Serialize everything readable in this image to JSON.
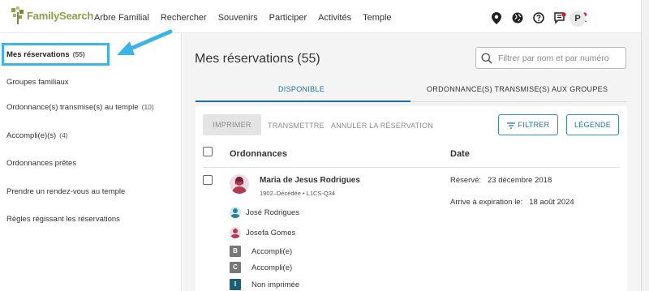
{
  "header": {
    "logo_text": "FamilySearch",
    "nav": [
      "Arbre Familial",
      "Rechercher",
      "Souvenirs",
      "Participer",
      "Activités",
      "Temple"
    ],
    "avatar_initial": "P"
  },
  "sidebar": {
    "items": [
      {
        "label": "Mes réservations",
        "count": "(55)"
      },
      {
        "label": "Groupes familiaux",
        "count": ""
      },
      {
        "label": "Ordonnance(s) transmise(s) au temple",
        "count": "(10)"
      },
      {
        "label": "Accompli(e)(s)",
        "count": "(4)"
      },
      {
        "label": "Ordonnances prêtes",
        "count": ""
      },
      {
        "label": "Prendre un rendez-vous au temple",
        "count": ""
      },
      {
        "label": "Règles régissant les réservations",
        "count": ""
      }
    ]
  },
  "main": {
    "title": "Mes réservations (55)",
    "search_placeholder": "Filtrer par nom et par numéro",
    "tabs": [
      "DISPONIBLE",
      "ORDONNANCE(S) TRANSMISE(S) AUX GROUPES"
    ],
    "toolbar": {
      "print": "IMPRIMER",
      "transmit": "TRANSMETTRE",
      "cancel": "ANNULER LA RÉSERVATION",
      "filter": "FILTRER",
      "legend": "LÉGENDE"
    },
    "columns": {
      "ordinances": "Ordonnances",
      "date": "Date"
    },
    "row": {
      "name": "Maria de Jesus Rodrigues",
      "meta": "1902–Décédée • L1CS-Q34",
      "reserved_label": "Réservé:",
      "reserved_value": "23 décembre 2018",
      "expires_label": "Arrive à expiration le:",
      "expires_value": "18 août 2024",
      "father": "José Rodrigues",
      "mother": "Josefa Gomes",
      "ordinances": [
        {
          "badge": "B",
          "status": "Accompli(e)",
          "color": "#777777"
        },
        {
          "badge": "C",
          "status": "Accompli(e)",
          "color": "#777777"
        },
        {
          "badge": "I",
          "status": "Non imprimée",
          "color": "#1e5f74"
        }
      ]
    }
  },
  "colors": {
    "accent": "#1f6fa3",
    "highlight": "#3cb4e6",
    "logo_green": "#8aa04b"
  }
}
